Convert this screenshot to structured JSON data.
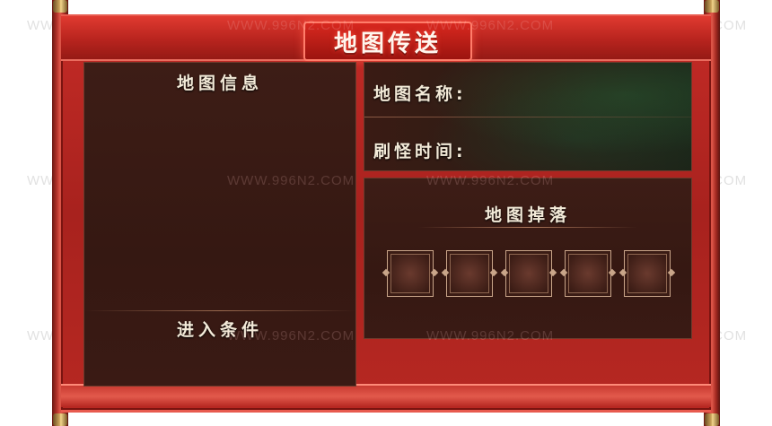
{
  "window": {
    "title": "地图传送"
  },
  "map_info": {
    "title": "地图信息",
    "entry_title": "进入条件"
  },
  "map_details": {
    "name_label": "地图名称:",
    "refresh_label": "刷怪时间:"
  },
  "drops": {
    "title": "地图掉落",
    "slots": [
      "",
      "",
      "",
      "",
      ""
    ]
  },
  "watermark": "WWW.996N2.COM",
  "colors": {
    "frame_red": "#c42b26",
    "panel_brown": "#3d1d16",
    "text": "#f3ead8"
  }
}
